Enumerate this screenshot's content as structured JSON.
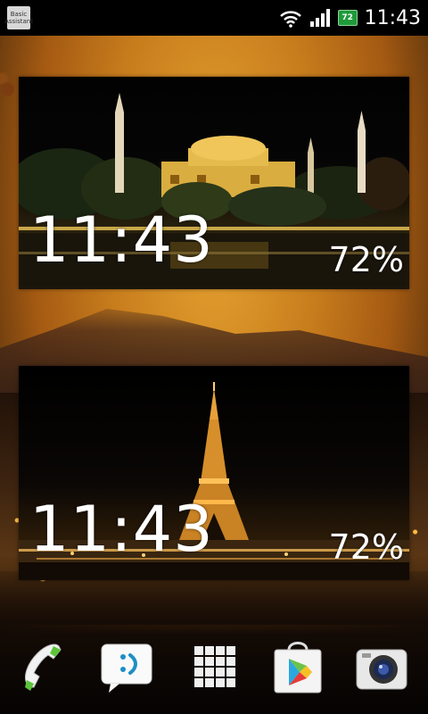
{
  "status_bar": {
    "time": "11:43",
    "battery_level": "72",
    "notification_app_line1": "Basic",
    "notification_app_line2": "Assistant",
    "icons": [
      "notification-app-icon",
      "wifi-icon",
      "signal-icon",
      "battery-icon"
    ]
  },
  "widgets": [
    {
      "time": "11:43",
      "battery": "72%",
      "scene": "hagia-sophia-night"
    },
    {
      "time": "11:43",
      "battery": "72%",
      "scene": "eiffel-tower-night"
    }
  ],
  "dock": {
    "items": [
      {
        "name": "phone-icon"
      },
      {
        "name": "messaging-icon"
      },
      {
        "name": "app-drawer-icon"
      },
      {
        "name": "play-store-icon"
      },
      {
        "name": "camera-icon"
      }
    ]
  },
  "colors": {
    "wallpaper": "#c87d1d",
    "statusbar": "#000000",
    "battery": "#1f9a3a"
  }
}
